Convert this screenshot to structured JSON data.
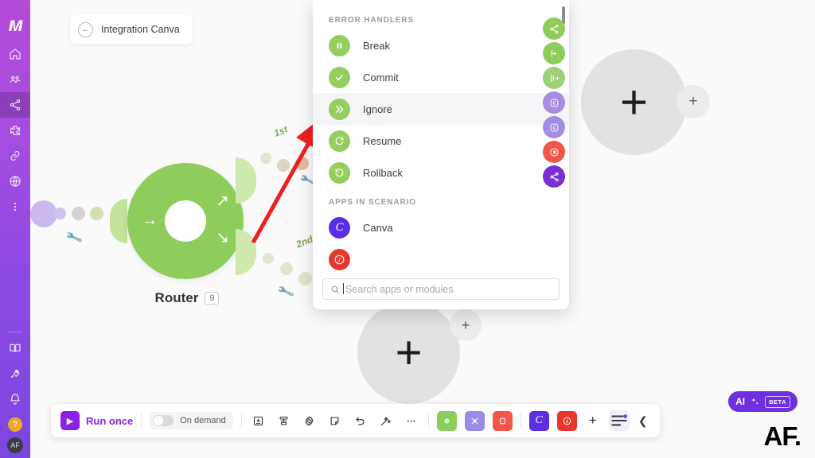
{
  "sidebar": {
    "logo_text": "м",
    "items": [
      {
        "name": "home",
        "icon": "home-icon",
        "active": false
      },
      {
        "name": "organization",
        "icon": "users-icon",
        "active": false
      },
      {
        "name": "scenarios",
        "icon": "share-nodes-icon",
        "active": true
      },
      {
        "name": "templates",
        "icon": "puzzle-icon",
        "active": false
      },
      {
        "name": "connections",
        "icon": "link-icon",
        "active": false
      },
      {
        "name": "webhooks",
        "icon": "globe-icon",
        "active": false
      },
      {
        "name": "more",
        "icon": "dots-vertical-icon",
        "active": false
      }
    ],
    "bottom_items": [
      {
        "name": "docs",
        "icon": "book-icon"
      },
      {
        "name": "whats-new",
        "icon": "rocket-icon"
      },
      {
        "name": "notifications",
        "icon": "bell-icon"
      }
    ],
    "help_label": "?",
    "avatar_label": "AF"
  },
  "breadcrumb": {
    "back_icon": "arrow-left-icon",
    "title": "Integration Canva"
  },
  "canvas": {
    "router": {
      "label": "Router",
      "badge": "9",
      "color": "#8ecc5c"
    },
    "route_labels": [
      "1st",
      "2nd"
    ],
    "add_node_plus": "+",
    "add_node_mini_plus": "+",
    "wrench_icon": "wrench-icon"
  },
  "palette": {
    "sections": [
      {
        "title": "ERROR HANDLERS",
        "items": [
          {
            "label": "Break",
            "icon": "pause-icon",
            "color": "#93cf5e",
            "selected": false
          },
          {
            "label": "Commit",
            "icon": "check-icon",
            "color": "#93cf5e",
            "selected": false
          },
          {
            "label": "Ignore",
            "icon": "double-chevron-right-icon",
            "color": "#93cf5e",
            "selected": true
          },
          {
            "label": "Resume",
            "icon": "rotate-right-icon",
            "color": "#93cf5e",
            "selected": false
          },
          {
            "label": "Rollback",
            "icon": "rotate-left-icon",
            "color": "#93cf5e",
            "selected": false
          }
        ]
      },
      {
        "title": "APPS IN SCENARIO",
        "items": [
          {
            "label": "Canva",
            "icon": "canva-icon",
            "color": "#5d2de6",
            "selected": false
          },
          {
            "label": "",
            "icon": "pinterest-icon",
            "color": "#e8372c",
            "selected": false
          }
        ]
      }
    ],
    "search": {
      "placeholder": "Search apps or modules",
      "value": "",
      "icon": "search-icon"
    },
    "scrollbar_icon": "scrollbar-thumb"
  },
  "module_strip": [
    {
      "name": "router-module",
      "icon": "share-nodes-icon",
      "color": "#8ecc5c"
    },
    {
      "name": "flow-module",
      "icon": "flow-icon",
      "color": "#8ecc5c"
    },
    {
      "name": "aggregator-module",
      "icon": "aggregator-icon",
      "color": "#9ed07a"
    },
    {
      "name": "canva-module-1",
      "icon": "canva-app-icon",
      "color": "#a58ce6"
    },
    {
      "name": "canva-module-2",
      "icon": "canva-app-icon",
      "color": "#a58ce6"
    },
    {
      "name": "pinterest-module",
      "icon": "pinterest-icon",
      "color": "#f0564a"
    },
    {
      "name": "router-module-2",
      "icon": "share-nodes-icon",
      "color": "#7a2fd4"
    }
  ],
  "toolbar": {
    "run_once_label": "Run once",
    "run_once_icon": "play-icon",
    "schedule_label": "On demand",
    "schedule_toggle_on": false,
    "tools": [
      {
        "name": "save-button",
        "icon": "save-icon"
      },
      {
        "name": "auto-align-button",
        "icon": "align-icon"
      },
      {
        "name": "settings-button",
        "icon": "gear-icon"
      },
      {
        "name": "notes-button",
        "icon": "note-icon"
      },
      {
        "name": "undo-button",
        "icon": "undo-icon"
      },
      {
        "name": "autoalign-magic-button",
        "icon": "magic-wand-icon"
      },
      {
        "name": "more-button",
        "icon": "ellipsis-icon"
      }
    ],
    "apps": [
      {
        "name": "tools-app",
        "icon": "tools-icon",
        "color": "#8ecc5c"
      },
      {
        "name": "flow-app",
        "icon": "flow-icon",
        "color": "#9b8ae8"
      },
      {
        "name": "text-app",
        "icon": "text-icon",
        "color": "#f0564a"
      },
      {
        "name": "canva-app",
        "icon": "canva-icon",
        "color": "#5d2de6"
      },
      {
        "name": "pinterest-app",
        "icon": "pinterest-icon",
        "color": "#e8372c"
      }
    ],
    "add_app_label": "+",
    "filter_icon": "filter-icon",
    "collapse_icon": "chevron-left-icon"
  },
  "ai_badge": {
    "label": "AI",
    "sparkle_icon": "sparkle-icon",
    "beta_label": "BETA"
  },
  "watermark": "AF."
}
